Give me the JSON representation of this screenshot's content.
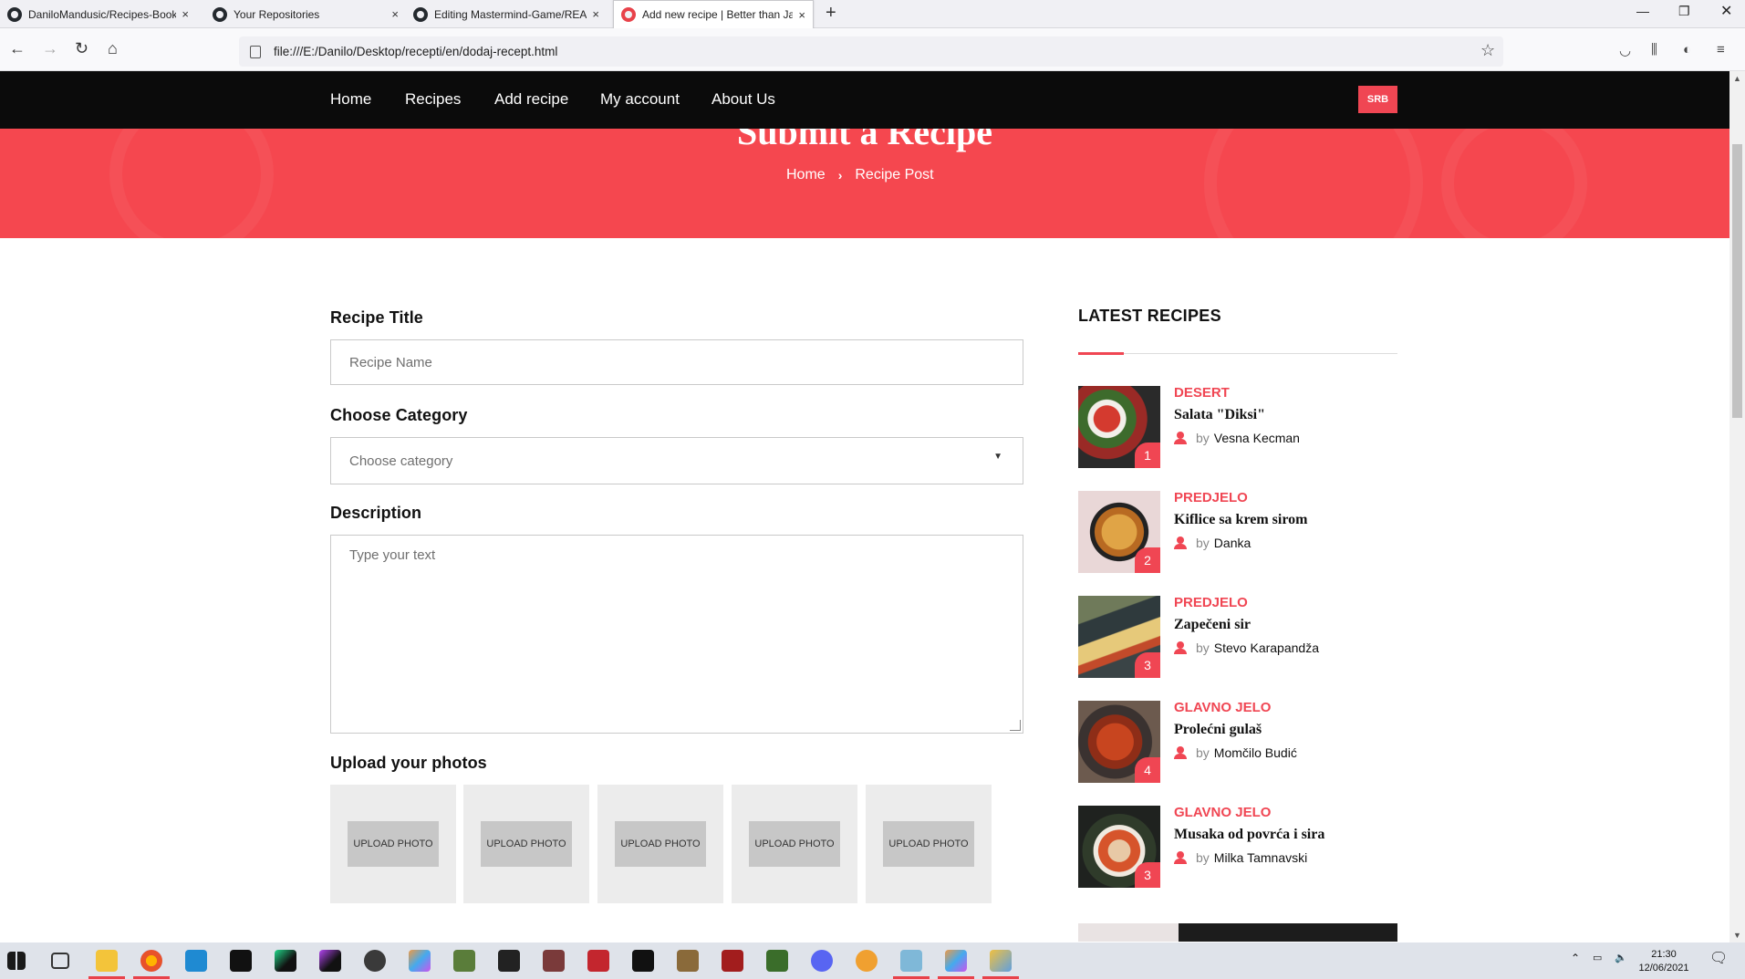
{
  "browser": {
    "tabs": [
      {
        "label": "DaniloMandusic/Recipes-Book",
        "active": false
      },
      {
        "label": "Your Repositories",
        "active": false
      },
      {
        "label": "Editing Mastermind-Game/READ",
        "active": false
      },
      {
        "label": "Add new recipe | Better than Jar",
        "active": true
      }
    ],
    "close_glyph": "×",
    "url": "file:///E:/Danilo/Desktop/recepti/en/dodaj-recept.html"
  },
  "nav": {
    "items": [
      "Home",
      "Recipes",
      "Add recipe",
      "My account",
      "About Us"
    ],
    "lang_button": "SRB"
  },
  "hero": {
    "title": "Submit a Recipe",
    "breadcrumb": [
      "Home",
      "Recipe Post"
    ]
  },
  "form": {
    "title_label": "Recipe Title",
    "title_placeholder": "Recipe Name",
    "category_label": "Choose Category",
    "category_selected": "Choose category",
    "description_label": "Description",
    "description_placeholder": "Type your text",
    "photos_label": "Upload your photos",
    "upload_buttons": [
      "UPLOAD PHOTO",
      "UPLOAD PHOTO",
      "UPLOAD PHOTO",
      "UPLOAD PHOTO",
      "UPLOAD PHOTO"
    ]
  },
  "sidebar": {
    "title": "LATEST RECIPES",
    "by_label": "by",
    "recipes": [
      {
        "category": "DESERT",
        "name": "Salata \"Diksi\"",
        "author": "Vesna Kecman",
        "rank": "1"
      },
      {
        "category": "PREDJELO",
        "name": "Kiflice sa krem sirom",
        "author": "Danka",
        "rank": "2"
      },
      {
        "category": "PREDJELO",
        "name": "Zapečeni sir",
        "author": "Stevo Karapandža",
        "rank": "3"
      },
      {
        "category": "GLAVNO JELO",
        "name": "Prolećni gulaš",
        "author": "Momčilo Budić",
        "rank": "4"
      },
      {
        "category": "GLAVNO JELO",
        "name": "Musaka od povrća i sira",
        "author": "Milka Tamnavski",
        "rank": "3"
      }
    ]
  },
  "taskbar": {
    "time": "21:30",
    "date": "12/06/2021"
  },
  "colors": {
    "accent": "#f04653",
    "nav_bg": "#0b0b0b",
    "hero_bg": "#f5474f"
  }
}
